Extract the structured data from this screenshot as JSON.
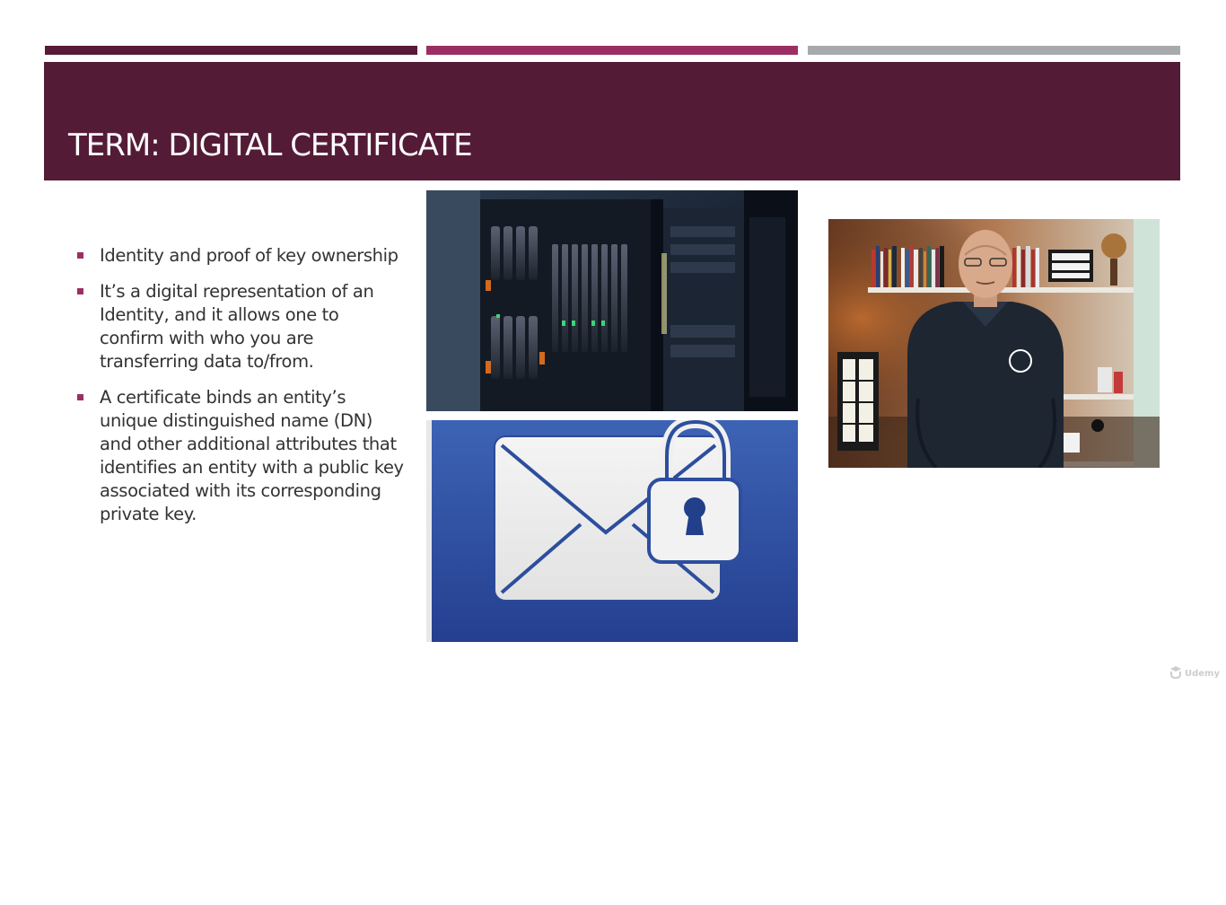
{
  "slide": {
    "title": "TERM: DIGITAL CERTIFICATE",
    "bullets": [
      {
        "text": "Identity and proof of key ownership"
      },
      {
        "text": "It’s a digital representation of an Identity, and it allows one to confirm with who you are transferring data to/from."
      },
      {
        "text": "A certificate binds an entity’s unique distinguished name (DN) and other additional attributes that identifies an entity with a public key associated with its corresponding private key."
      }
    ]
  },
  "images": {
    "server": {
      "icon": "server-rack-image"
    },
    "email_lock": {
      "icon": "email-lock-icon"
    },
    "presenter": {
      "icon": "presenter-video"
    }
  },
  "watermark": {
    "text": "Udemy",
    "icon": "udemy-logo-icon"
  },
  "colors": {
    "bar_dark": "#581a37",
    "bar_mid": "#9b2f63",
    "bar_gray": "#a7a9ad",
    "banner": "#541b36",
    "bullet_marker": "#9b2f63",
    "text": "#333333"
  }
}
